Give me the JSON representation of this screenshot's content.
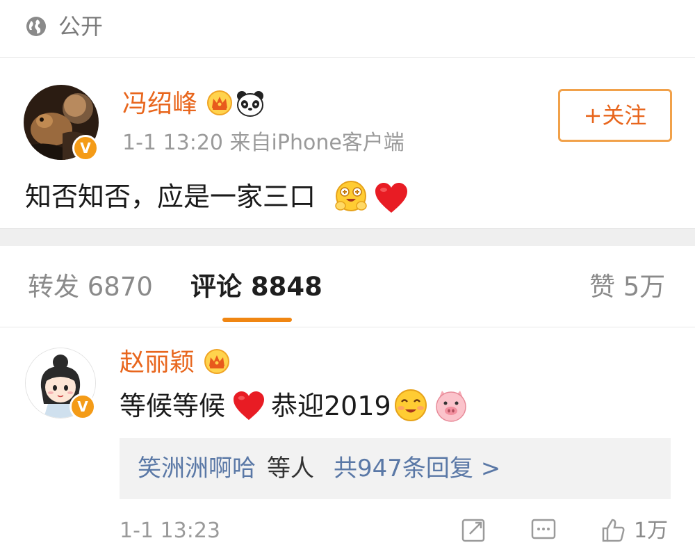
{
  "visibility": {
    "icon": "globe-icon",
    "label": "公开"
  },
  "post": {
    "author": "冯绍峰",
    "badges": [
      "crown-icon",
      "panda-icon"
    ],
    "verified": "V",
    "time_source": "1-1 13:20  来自iPhone客户端",
    "follow_label": "+关注",
    "text": "知否知否，应是一家三口",
    "emojis": [
      "hug-emoji",
      "heart-emoji"
    ]
  },
  "tabs": {
    "repost": "转发 6870",
    "comments": "评论 8848",
    "likes": "赞 5万"
  },
  "comment": {
    "author": "赵丽颖",
    "badge": "crown-icon",
    "verified": "V",
    "text_part1": "等候等候",
    "text_part2": "恭迎2019",
    "emojis": [
      "heart-emoji",
      "shy-smile-emoji",
      "pig-emoji"
    ],
    "replies": {
      "users": "笑洲洲啊哈",
      "etc": "等人",
      "count": "共947条回复 >"
    },
    "time": "1-1 13:23",
    "like_count": "1万"
  },
  "colors": {
    "accent": "#e8661d",
    "tab_underline": "#f08612",
    "link_blue": "#5a78a6",
    "meta_gray": "#9a9a9a"
  }
}
